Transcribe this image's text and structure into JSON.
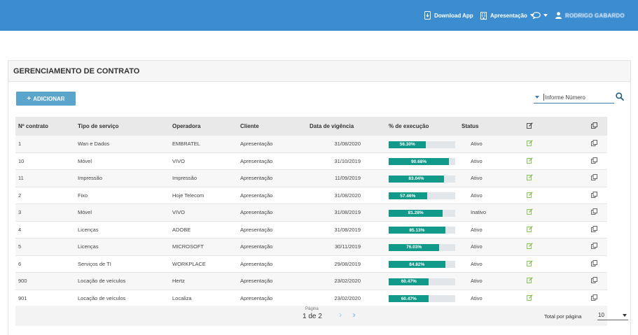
{
  "topbar": {
    "download_label": "Download App",
    "workspace_label": "Apresentação",
    "user_name": "RODRIGO GABARDO"
  },
  "panel": {
    "title": "GERENCIAMENTO DE CONTRATO"
  },
  "toolbar": {
    "add_label": "ADICIONAR"
  },
  "search": {
    "placeholder": "Informe Número"
  },
  "table": {
    "headers": {
      "num": "Nº contrato",
      "tipo": "Tipo de serviço",
      "oper": "Operadora",
      "cli": "Cliente",
      "data": "Data de vigência",
      "exec": "% de execução",
      "status": "Status"
    },
    "rows": [
      {
        "num": "1",
        "tipo": "Wan e Dados",
        "oper": "EMBRATEL",
        "cli": "Apresentação",
        "data": "31/08/2020",
        "exec_label": "56.30%",
        "exec": 56.3,
        "status": "Ativo"
      },
      {
        "num": "10",
        "tipo": "Móvel",
        "oper": "VIVO",
        "cli": "Apresentação",
        "data": "31/10/2019",
        "exec_label": "90.68%",
        "exec": 90.68,
        "status": "Ativo"
      },
      {
        "num": "11",
        "tipo": "Impressão",
        "oper": "Impressão",
        "cli": "Apresentação",
        "data": "11/09/2019",
        "exec_label": "83.04%",
        "exec": 83.04,
        "status": "Ativo"
      },
      {
        "num": "2",
        "tipo": "Fixo",
        "oper": "Hoje Telecom",
        "cli": "Apresentação",
        "data": "31/08/2020",
        "exec_label": "57.46%",
        "exec": 57.46,
        "status": "Ativo"
      },
      {
        "num": "3",
        "tipo": "Móvel",
        "oper": "VIVO",
        "cli": "Apresentação",
        "data": "31/08/2019",
        "exec_label": "81.28%",
        "exec": 81.28,
        "status": "Inativo"
      },
      {
        "num": "4",
        "tipo": "Licenças",
        "oper": "ADOBE",
        "cli": "Apresentação",
        "data": "31/08/2019",
        "exec_label": "85.13%",
        "exec": 85.13,
        "status": "Ativo"
      },
      {
        "num": "5",
        "tipo": "Licenças",
        "oper": "MICROSOFT",
        "cli": "Apresentação",
        "data": "30/11/2019",
        "exec_label": "76.03%",
        "exec": 76.03,
        "status": "Ativo"
      },
      {
        "num": "6",
        "tipo": "Serviços de TI",
        "oper": "WORKPLACE",
        "cli": "Apresentação",
        "data": "29/08/2019",
        "exec_label": "84.82%",
        "exec": 84.82,
        "status": "Ativo"
      },
      {
        "num": "900",
        "tipo": "Locação de veículos",
        "oper": "Hertz",
        "cli": "Apresentação",
        "data": "23/02/2020",
        "exec_label": "60.47%",
        "exec": 60.47,
        "status": "Ativo"
      },
      {
        "num": "901",
        "tipo": "Locação de veículos",
        "oper": "Localiza",
        "cli": "Apresentação",
        "data": "23/02/2020",
        "exec_label": "60.47%",
        "exec": 60.47,
        "status": "Ativo"
      }
    ]
  },
  "pagination": {
    "page_label": "Página",
    "page_value": "1 de 2",
    "per_page_label": "Total por página",
    "per_page_value": "10"
  },
  "colors": {
    "topbar": "#3c8dcf",
    "bar_fill": "#11998a",
    "edit_icon": "#7cc04b",
    "add_button": "#5ba5cc"
  },
  "icons": {
    "download": "download-app-icon",
    "workspace": "building-icon",
    "chat": "chat-bubble-icon",
    "user": "user-icon",
    "search": "search-icon",
    "edit": "edit-icon",
    "copy": "copy-icon"
  }
}
